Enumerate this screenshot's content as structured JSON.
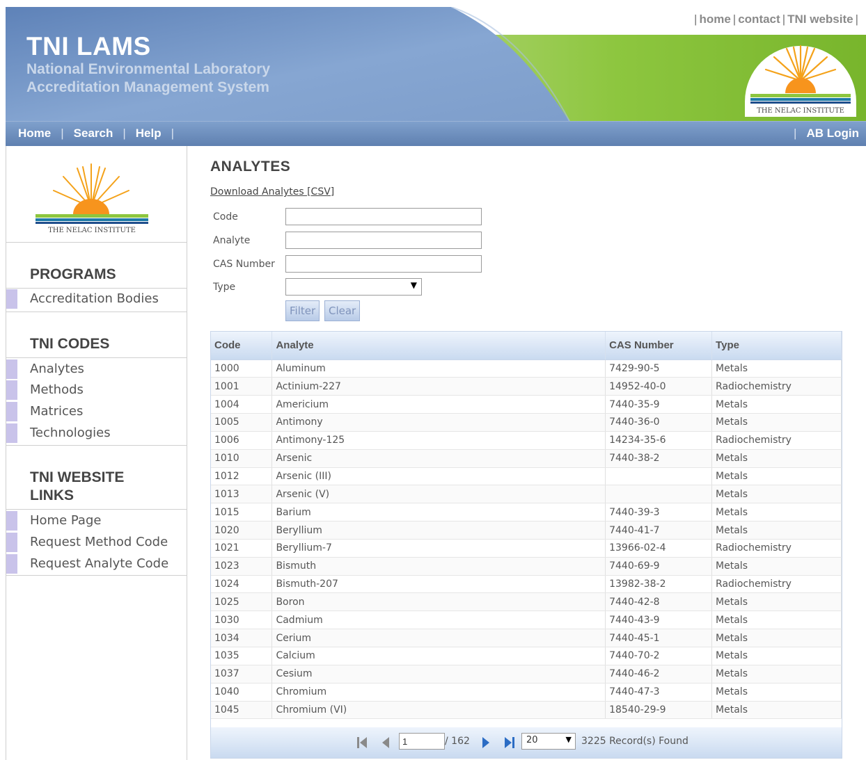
{
  "header": {
    "title": "TNI LAMS",
    "subtitle_line1": "National Environmental Laboratory",
    "subtitle_line2": "Accreditation Management System",
    "top_links": [
      "home",
      "contact",
      "TNI website"
    ],
    "logo_text": "THE NELAC INSTITUTE"
  },
  "nav": {
    "items": [
      "Home",
      "Search",
      "Help"
    ],
    "right": "AB Login"
  },
  "sidebar": {
    "logo_text": "THE NELAC INSTITUTE",
    "programs_heading": "PROGRAMS",
    "programs_items": [
      "Accreditation Bodies"
    ],
    "codes_heading": "TNI CODES",
    "codes_items": [
      "Analytes",
      "Methods",
      "Matrices",
      "Technologies"
    ],
    "links_heading_line1": "TNI WEBSITE",
    "links_heading_line2": "LINKS",
    "links_items": [
      "Home Page",
      "Request Method Code",
      "Request Analyte Code"
    ]
  },
  "main": {
    "title": "ANALYTES",
    "download_link": "Download Analytes [CSV]",
    "filters": {
      "code_label": "Code",
      "code_value": "",
      "analyte_label": "Analyte",
      "analyte_value": "",
      "cas_label": "CAS Number",
      "cas_value": "",
      "type_label": "Type",
      "type_value": ""
    },
    "buttons": {
      "filter": "Filter",
      "clear": "Clear"
    },
    "table": {
      "headers": [
        "Code",
        "Analyte",
        "CAS Number",
        "Type"
      ],
      "rows": [
        [
          "1000",
          "Aluminum",
          "7429-90-5",
          "Metals"
        ],
        [
          "1001",
          "Actinium-227",
          "14952-40-0",
          "Radiochemistry"
        ],
        [
          "1004",
          "Americium",
          "7440-35-9",
          "Metals"
        ],
        [
          "1005",
          "Antimony",
          "7440-36-0",
          "Metals"
        ],
        [
          "1006",
          "Antimony-125",
          "14234-35-6",
          "Radiochemistry"
        ],
        [
          "1010",
          "Arsenic",
          "7440-38-2",
          "Metals"
        ],
        [
          "1012",
          "Arsenic (III)",
          "",
          "Metals"
        ],
        [
          "1013",
          "Arsenic (V)",
          "",
          "Metals"
        ],
        [
          "1015",
          "Barium",
          "7440-39-3",
          "Metals"
        ],
        [
          "1020",
          "Beryllium",
          "7440-41-7",
          "Metals"
        ],
        [
          "1021",
          "Beryllium-7",
          "13966-02-4",
          "Radiochemistry"
        ],
        [
          "1023",
          "Bismuth",
          "7440-69-9",
          "Metals"
        ],
        [
          "1024",
          "Bismuth-207",
          "13982-38-2",
          "Radiochemistry"
        ],
        [
          "1025",
          "Boron",
          "7440-42-8",
          "Metals"
        ],
        [
          "1030",
          "Cadmium",
          "7440-43-9",
          "Metals"
        ],
        [
          "1034",
          "Cerium",
          "7440-45-1",
          "Metals"
        ],
        [
          "1035",
          "Calcium",
          "7440-70-2",
          "Metals"
        ],
        [
          "1037",
          "Cesium",
          "7440-46-2",
          "Metals"
        ],
        [
          "1040",
          "Chromium",
          "7440-47-3",
          "Metals"
        ],
        [
          "1045",
          "Chromium (VI)",
          "18540-29-9",
          "Metals"
        ]
      ]
    },
    "pager": {
      "page": "1",
      "total_pages": "/ 162",
      "page_size": "20",
      "records": "3225 Record(s) Found"
    }
  },
  "colors": {
    "nav_bar": "#6f90c0",
    "header_blue": "#6b8fc2",
    "header_green": "#8ec63f",
    "sidebar_marker": "#c9c3ea"
  }
}
